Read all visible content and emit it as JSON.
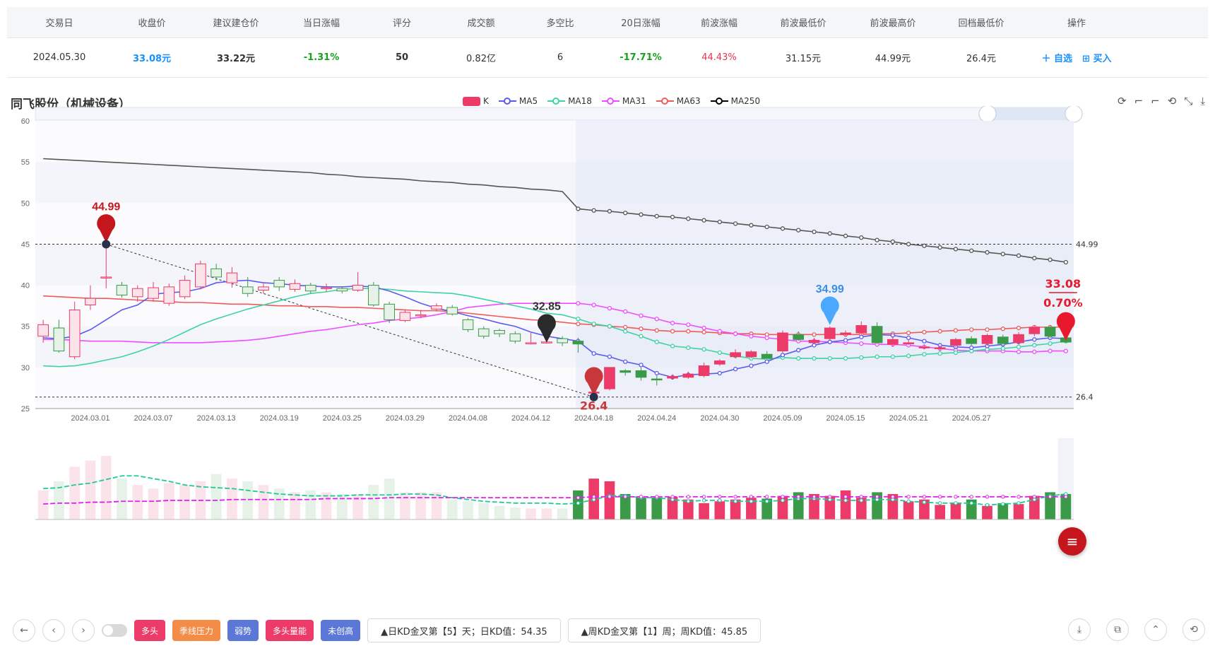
{
  "table": {
    "headers": [
      "交易日",
      "收盘价",
      "建议建仓价",
      "当日涨幅",
      "评分",
      "成交额",
      "多空比",
      "20日涨幅",
      "前波涨幅",
      "前波最低价",
      "前波最高价",
      "回档最低价",
      "操作"
    ],
    "row": [
      "2024.05.30",
      "33.08元",
      "33.22元",
      "-1.31%",
      "50",
      "0.82亿",
      "6",
      "-17.71%",
      "44.43%",
      "31.15元",
      "44.99元",
      "26.4元"
    ],
    "actions": [
      "＋ 自选",
      "⊞ 买入"
    ]
  },
  "title": "同飞股份（机械设备）",
  "legend": [
    "K",
    "MA5",
    "MA18",
    "MA31",
    "MA63",
    "MA250"
  ],
  "colors": {
    "up": "#ec3b68",
    "down": "#3a9a48",
    "ma5": "#5b5bf0",
    "ma18": "#3dd3a3",
    "ma31": "#ef4dff",
    "ma63": "#ef5b5b",
    "ma250": "#555555"
  },
  "chart_data": {
    "type": "candlestick",
    "ylim": [
      25,
      60
    ],
    "yticks": [
      "60",
      "55",
      "50",
      "45",
      "40",
      "35",
      "30",
      "25"
    ],
    "xticks": [
      "2024.03.01",
      "2024.03.07",
      "2024.03.13",
      "2024.03.19",
      "2024.03.25",
      "2024.03.29",
      "2024.04.08",
      "2024.04.12",
      "2024.04.18",
      "2024.04.24",
      "2024.04.30",
      "2024.05.09",
      "2024.05.15",
      "2024.05.21",
      "2024.05.27"
    ],
    "candles": [
      [
        33.8,
        35.2,
        35.8,
        33.0
      ],
      [
        34.8,
        32.0,
        35.8,
        31.8
      ],
      [
        31.3,
        37.0,
        38.0,
        31.0
      ],
      [
        37.6,
        38.4,
        40.0,
        37.0
      ],
      [
        41.0,
        41.0,
        45.0,
        39.6
      ],
      [
        40.0,
        38.8,
        40.4,
        38.5
      ],
      [
        38.6,
        39.6,
        40.0,
        38.0
      ],
      [
        38.4,
        39.7,
        40.4,
        38.0
      ],
      [
        37.8,
        39.8,
        40.2,
        37.5
      ],
      [
        38.6,
        40.6,
        41.2,
        38.3
      ],
      [
        39.8,
        42.6,
        43.0,
        39.5
      ],
      [
        42.0,
        41.0,
        42.6,
        40.6
      ],
      [
        40.3,
        41.5,
        42.2,
        39.7
      ],
      [
        39.8,
        39.0,
        41.0,
        38.6
      ],
      [
        39.4,
        39.8,
        40.2,
        39.0
      ],
      [
        40.6,
        39.8,
        41.0,
        39.3
      ],
      [
        39.5,
        40.2,
        40.7,
        39.2
      ],
      [
        40.0,
        39.3,
        40.3,
        39.0
      ],
      [
        39.7,
        39.7,
        40.2,
        39.2
      ],
      [
        39.6,
        39.3,
        39.8,
        39.0
      ],
      [
        39.4,
        40.0,
        41.6,
        39.2
      ],
      [
        40.0,
        37.6,
        40.4,
        37.4
      ],
      [
        37.7,
        35.8,
        38.0,
        35.4
      ],
      [
        35.7,
        36.7,
        37.0,
        35.5
      ],
      [
        36.4,
        36.4,
        37.0,
        36.0
      ],
      [
        37.1,
        37.5,
        37.8,
        36.8
      ],
      [
        37.3,
        36.5,
        37.6,
        36.3
      ],
      [
        35.8,
        34.6,
        36.0,
        34.3
      ],
      [
        34.7,
        33.8,
        35.0,
        33.5
      ],
      [
        34.5,
        34.1,
        34.7,
        33.7
      ],
      [
        34.1,
        33.2,
        34.4,
        32.9
      ],
      [
        33.0,
        33.0,
        34.2,
        32.8
      ],
      [
        33.0,
        33.1,
        33.4,
        32.9
      ],
      [
        33.5,
        33.0,
        33.8,
        32.6
      ],
      [
        33.2,
        32.85,
        33.6,
        31.8
      ],
      [
        27.0,
        27.0,
        27.4,
        26.4
      ],
      [
        27.4,
        30.0,
        30.0,
        27.2
      ],
      [
        29.6,
        29.4,
        29.8,
        29.0
      ],
      [
        29.6,
        28.8,
        30.0,
        28.4
      ],
      [
        28.6,
        28.5,
        29.0,
        27.8
      ],
      [
        28.7,
        28.9,
        29.2,
        28.5
      ],
      [
        28.8,
        29.2,
        29.5,
        28.6
      ],
      [
        29.0,
        30.2,
        30.6,
        28.8
      ],
      [
        30.4,
        30.8,
        31.0,
        30.2
      ],
      [
        31.3,
        31.8,
        32.2,
        31.1
      ],
      [
        31.3,
        31.9,
        32.1,
        31.1
      ],
      [
        31.6,
        31.1,
        32.0,
        30.9
      ],
      [
        32.0,
        34.2,
        34.5,
        31.8
      ],
      [
        34.0,
        33.4,
        34.4,
        33.2
      ],
      [
        33.0,
        33.3,
        33.6,
        32.9
      ],
      [
        33.5,
        34.8,
        35.0,
        33.3
      ],
      [
        34.0,
        34.2,
        34.5,
        33.8
      ],
      [
        34.2,
        35.1,
        35.6,
        33.9
      ],
      [
        35.0,
        33.0,
        35.5,
        32.8
      ],
      [
        32.8,
        33.4,
        33.8,
        32.5
      ],
      [
        33.0,
        33.0,
        33.4,
        32.7
      ],
      [
        32.5,
        32.5,
        32.8,
        32.2
      ],
      [
        32.3,
        32.4,
        32.7,
        32.0
      ],
      [
        32.7,
        33.4,
        33.6,
        32.4
      ],
      [
        33.5,
        32.9,
        33.8,
        32.7
      ],
      [
        32.9,
        33.9,
        34.1,
        32.6
      ],
      [
        33.7,
        32.9,
        34.0,
        32.6
      ],
      [
        33.0,
        34.0,
        34.3,
        32.8
      ],
      [
        34.1,
        34.9,
        35.1,
        33.8
      ],
      [
        34.9,
        33.8,
        35.1,
        33.5
      ],
      [
        33.6,
        33.08,
        34.0,
        33.0
      ]
    ],
    "ma5": [
      33.6,
      33.5,
      33.8,
      34.6,
      35.8,
      37.0,
      37.6,
      38.9,
      39.1,
      39.2,
      39.6,
      40.3,
      40.5,
      40.6,
      40.3,
      40.2,
      40.0,
      39.9,
      39.8,
      39.8,
      39.9,
      39.8,
      39.3,
      38.6,
      37.8,
      37.2,
      36.8,
      36.3,
      35.9,
      35.4,
      35.0,
      34.3,
      33.8,
      33.5,
      33.2,
      31.7,
      31.3,
      30.7,
      30.3,
      29.3,
      28.8,
      29.1,
      29.2,
      29.3,
      29.8,
      30.2,
      30.7,
      31.5,
      32.1,
      32.7,
      33.1,
      33.3,
      33.7,
      34.0,
      33.9,
      33.6,
      33.2,
      32.7,
      32.5,
      32.4,
      32.6,
      32.8,
      33.1,
      33.4,
      33.6,
      33.5
    ],
    "ma18": [
      30.2,
      30.1,
      30.2,
      30.5,
      30.9,
      31.3,
      31.9,
      32.6,
      33.4,
      34.3,
      35.2,
      35.9,
      36.5,
      37.1,
      37.6,
      38.1,
      38.6,
      39.0,
      39.2,
      39.5,
      39.6,
      39.6,
      39.5,
      39.3,
      39.2,
      39.1,
      39.0,
      38.7,
      38.3,
      37.9,
      37.5,
      37.1,
      36.6,
      36.4,
      35.9,
      35.3,
      35.0,
      34.4,
      33.8,
      33.1,
      32.6,
      32.4,
      32.2,
      31.8,
      31.4,
      31.1,
      31.0,
      31.2,
      31.1,
      31.1,
      31.1,
      31.1,
      31.2,
      31.3,
      31.3,
      31.4,
      31.6,
      31.7,
      31.8,
      32.0,
      32.2,
      32.3,
      32.5,
      32.7,
      32.9,
      33.2
    ],
    "ma31": [
      33.4,
      33.4,
      33.3,
      33.2,
      33.2,
      33.2,
      33.1,
      33.0,
      33.0,
      33.0,
      33.0,
      33.1,
      33.2,
      33.3,
      33.5,
      33.8,
      34.1,
      34.4,
      34.6,
      34.9,
      35.2,
      35.4,
      35.7,
      35.9,
      36.1,
      36.4,
      36.8,
      37.3,
      37.5,
      37.7,
      37.8,
      37.8,
      37.8,
      37.8,
      37.8,
      37.6,
      37.2,
      36.8,
      36.3,
      35.9,
      35.4,
      35.2,
      34.8,
      34.4,
      34.1,
      33.8,
      33.6,
      33.4,
      33.2,
      33.2,
      33.1,
      33.0,
      32.9,
      32.8,
      32.8,
      32.7,
      32.5,
      32.3,
      32.1,
      32.0,
      32.0,
      32.0,
      31.9,
      31.9,
      32.0,
      32.0
    ],
    "ma63": [
      38.7,
      38.6,
      38.5,
      38.4,
      38.4,
      38.3,
      38.2,
      38.1,
      38.0,
      37.9,
      37.9,
      37.8,
      37.7,
      37.7,
      37.6,
      37.5,
      37.5,
      37.4,
      37.4,
      37.3,
      37.3,
      37.2,
      37.1,
      37.0,
      36.9,
      36.9,
      36.8,
      36.6,
      36.4,
      36.2,
      36.0,
      35.8,
      35.7,
      35.5,
      35.3,
      35.2,
      35.0,
      34.9,
      34.7,
      34.5,
      34.4,
      34.4,
      34.3,
      34.2,
      34.1,
      34.1,
      34.0,
      34.0,
      34.0,
      34.0,
      34.0,
      34.0,
      34.0,
      34.1,
      34.1,
      34.2,
      34.3,
      34.4,
      34.5,
      34.6,
      34.6,
      34.7,
      34.8,
      34.9,
      34.9,
      34.9
    ],
    "ma250": [
      55.4,
      55.3,
      55.2,
      55.1,
      55.0,
      54.9,
      54.8,
      54.7,
      54.6,
      54.5,
      54.4,
      54.3,
      54.2,
      54.1,
      54.0,
      53.9,
      53.8,
      53.7,
      53.5,
      53.4,
      53.2,
      53.1,
      53.0,
      52.9,
      52.7,
      52.6,
      52.5,
      52.3,
      52.2,
      52.0,
      51.9,
      51.7,
      51.6,
      51.4,
      49.3,
      49.1,
      49.0,
      48.8,
      48.6,
      48.4,
      48.3,
      48.1,
      47.9,
      47.7,
      47.5,
      47.3,
      47.1,
      46.9,
      46.7,
      46.5,
      46.3,
      46.0,
      45.8,
      45.5,
      45.3,
      45.0,
      44.8,
      44.6,
      44.4,
      44.2,
      44.0,
      43.8,
      43.6,
      43.3,
      43.1,
      42.8
    ],
    "volume": [
      32,
      42,
      58,
      65,
      70,
      45,
      38,
      34,
      40,
      38,
      42,
      50,
      45,
      42,
      38,
      34,
      30,
      32,
      30,
      28,
      28,
      38,
      45,
      30,
      30,
      30,
      22,
      20,
      18,
      15,
      13,
      12,
      12,
      12,
      32,
      45,
      42,
      28,
      24,
      24,
      25,
      22,
      18,
      20,
      22,
      24,
      23,
      26,
      30,
      28,
      26,
      32,
      24,
      30,
      28,
      20,
      22,
      16,
      18,
      22,
      15,
      18,
      17,
      26,
      30,
      28
    ],
    "volume_line1": [
      34,
      35,
      38,
      40,
      44,
      48,
      48,
      45,
      42,
      38,
      36,
      35,
      34,
      32,
      30,
      28,
      27,
      26,
      26,
      26,
      27,
      27,
      27,
      28,
      28,
      27,
      24,
      22,
      20,
      19,
      18,
      18,
      18,
      17,
      18,
      22,
      26,
      26,
      24,
      24,
      22,
      20,
      21,
      21,
      20,
      20,
      20,
      21,
      23,
      23,
      22,
      21,
      21,
      22,
      22,
      20,
      19,
      18,
      18,
      18,
      16,
      17,
      18,
      22,
      26,
      28
    ],
    "volume_line2": [
      17,
      18,
      18,
      19,
      19,
      20,
      20,
      20,
      21,
      21,
      21,
      21,
      22,
      22,
      22,
      22,
      22,
      22,
      23,
      23,
      23,
      23,
      24,
      24,
      24,
      24,
      24,
      24,
      24,
      24,
      24,
      24,
      24,
      24,
      24,
      25,
      25,
      25,
      25,
      25,
      25,
      25,
      25,
      25,
      25,
      25,
      25,
      25,
      25,
      25,
      25,
      25,
      25,
      25,
      25,
      25,
      25,
      25,
      25,
      25,
      25,
      25,
      25,
      25,
      25,
      25
    ],
    "markers": {
      "high": "44.99",
      "low": "26.4",
      "mid": "32.85",
      "blue": "34.99",
      "last": "33.08",
      "last_pct": "0.70%"
    },
    "right_labels": [
      "44.99",
      "26.4"
    ]
  },
  "tags": [
    {
      "label": "多头",
      "color": "#ec3b68"
    },
    {
      "label": "季线压力",
      "color": "#f28c47"
    },
    {
      "label": "弱势",
      "color": "#5b78d9"
    },
    {
      "label": "多头量能",
      "color": "#ec3b68"
    },
    {
      "label": "未创高",
      "color": "#5b78d9"
    }
  ],
  "info1": "▲日KD金叉第【5】天；日KD值：54.35",
  "info2": "▲周KD金叉第【1】周；周KD值：45.85",
  "nav": {
    "back": "←",
    "prev": "‹",
    "next": "›"
  },
  "tools": [
    "⟳",
    "⌐",
    "⌐",
    "⟲",
    "⤡",
    "⤓"
  ],
  "rightbtns": [
    "⤓",
    "⧉",
    "⌃",
    "⟲"
  ],
  "fab": "≡"
}
